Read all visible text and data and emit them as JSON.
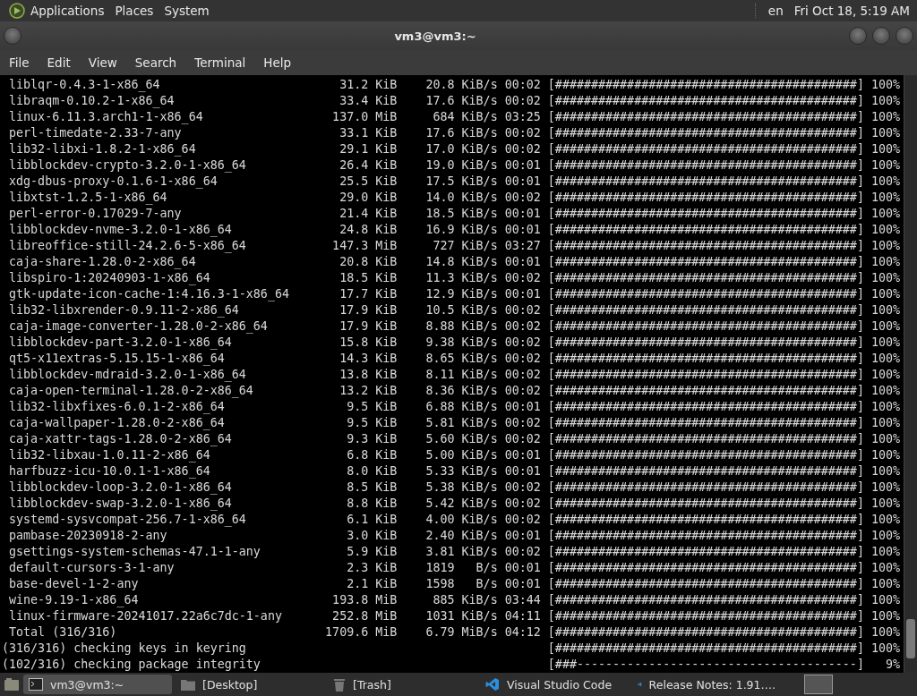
{
  "top_panel": {
    "menus": [
      "Applications",
      "Places",
      "System"
    ],
    "keyboard": "en",
    "clock": "Fri Oct 18, 5:19 AM"
  },
  "window": {
    "title": "vm3@vm3:~"
  },
  "menu_bar": [
    "File",
    "Edit",
    "View",
    "Search",
    "Terminal",
    "Help"
  ],
  "terminal": {
    "lines": [
      {
        "kind": "download",
        "name": "liblqr-0.4.3-1-x86_64",
        "size": "31.2 KiB",
        "rate": "20.8",
        "unit": "KiB/s",
        "time": "00:02",
        "bar": "[##########################################]",
        "percent": "100%"
      },
      {
        "kind": "download",
        "name": "libraqm-0.10.2-1-x86_64",
        "size": "33.4 KiB",
        "rate": "17.6",
        "unit": "KiB/s",
        "time": "00:02",
        "bar": "[##########################################]",
        "percent": "100%"
      },
      {
        "kind": "download",
        "name": "linux-6.11.3.arch1-1-x86_64",
        "size": "137.0 MiB",
        "rate": "684",
        "unit": "KiB/s",
        "time": "03:25",
        "bar": "[##########################################]",
        "percent": "100%"
      },
      {
        "kind": "download",
        "name": "perl-timedate-2.33-7-any",
        "size": "33.1 KiB",
        "rate": "17.6",
        "unit": "KiB/s",
        "time": "00:02",
        "bar": "[##########################################]",
        "percent": "100%"
      },
      {
        "kind": "download",
        "name": "lib32-libxi-1.8.2-1-x86_64",
        "size": "29.1 KiB",
        "rate": "17.0",
        "unit": "KiB/s",
        "time": "00:02",
        "bar": "[##########################################]",
        "percent": "100%"
      },
      {
        "kind": "download",
        "name": "libblockdev-crypto-3.2.0-1-x86_64",
        "size": "26.4 KiB",
        "rate": "19.0",
        "unit": "KiB/s",
        "time": "00:01",
        "bar": "[##########################################]",
        "percent": "100%"
      },
      {
        "kind": "download",
        "name": "xdg-dbus-proxy-0.1.6-1-x86_64",
        "size": "25.5 KiB",
        "rate": "17.5",
        "unit": "KiB/s",
        "time": "00:01",
        "bar": "[##########################################]",
        "percent": "100%"
      },
      {
        "kind": "download",
        "name": "libxtst-1.2.5-1-x86_64",
        "size": "29.0 KiB",
        "rate": "14.0",
        "unit": "KiB/s",
        "time": "00:02",
        "bar": "[##########################################]",
        "percent": "100%"
      },
      {
        "kind": "download",
        "name": "perl-error-0.17029-7-any",
        "size": "21.4 KiB",
        "rate": "18.5",
        "unit": "KiB/s",
        "time": "00:01",
        "bar": "[##########################################]",
        "percent": "100%"
      },
      {
        "kind": "download",
        "name": "libblockdev-nvme-3.2.0-1-x86_64",
        "size": "24.8 KiB",
        "rate": "16.9",
        "unit": "KiB/s",
        "time": "00:01",
        "bar": "[##########################################]",
        "percent": "100%"
      },
      {
        "kind": "download",
        "name": "libreoffice-still-24.2.6-5-x86_64",
        "size": "147.3 MiB",
        "rate": "727",
        "unit": "KiB/s",
        "time": "03:27",
        "bar": "[##########################################]",
        "percent": "100%"
      },
      {
        "kind": "download",
        "name": "caja-share-1.28.0-2-x86_64",
        "size": "20.8 KiB",
        "rate": "14.8",
        "unit": "KiB/s",
        "time": "00:01",
        "bar": "[##########################################]",
        "percent": "100%"
      },
      {
        "kind": "download",
        "name": "libspiro-1:20240903-1-x86_64",
        "size": "18.5 KiB",
        "rate": "11.3",
        "unit": "KiB/s",
        "time": "00:02",
        "bar": "[##########################################]",
        "percent": "100%"
      },
      {
        "kind": "download",
        "name": "gtk-update-icon-cache-1:4.16.3-1-x86_64",
        "size": "17.7 KiB",
        "rate": "12.9",
        "unit": "KiB/s",
        "time": "00:01",
        "bar": "[##########################################]",
        "percent": "100%"
      },
      {
        "kind": "download",
        "name": "lib32-libxrender-0.9.11-2-x86_64",
        "size": "17.9 KiB",
        "rate": "10.5",
        "unit": "KiB/s",
        "time": "00:02",
        "bar": "[##########################################]",
        "percent": "100%"
      },
      {
        "kind": "download",
        "name": "caja-image-converter-1.28.0-2-x86_64",
        "size": "17.9 KiB",
        "rate": "8.88",
        "unit": "KiB/s",
        "time": "00:02",
        "bar": "[##########################################]",
        "percent": "100%"
      },
      {
        "kind": "download",
        "name": "libblockdev-part-3.2.0-1-x86_64",
        "size": "15.8 KiB",
        "rate": "9.38",
        "unit": "KiB/s",
        "time": "00:02",
        "bar": "[##########################################]",
        "percent": "100%"
      },
      {
        "kind": "download",
        "name": "qt5-x11extras-5.15.15-1-x86_64",
        "size": "14.3 KiB",
        "rate": "8.65",
        "unit": "KiB/s",
        "time": "00:02",
        "bar": "[##########################################]",
        "percent": "100%"
      },
      {
        "kind": "download",
        "name": "libblockdev-mdraid-3.2.0-1-x86_64",
        "size": "13.8 KiB",
        "rate": "8.11",
        "unit": "KiB/s",
        "time": "00:02",
        "bar": "[##########################################]",
        "percent": "100%"
      },
      {
        "kind": "download",
        "name": "caja-open-terminal-1.28.0-2-x86_64",
        "size": "13.2 KiB",
        "rate": "8.36",
        "unit": "KiB/s",
        "time": "00:02",
        "bar": "[##########################################]",
        "percent": "100%"
      },
      {
        "kind": "download",
        "name": "lib32-libxfixes-6.0.1-2-x86_64",
        "size": "9.5 KiB",
        "rate": "6.88",
        "unit": "KiB/s",
        "time": "00:01",
        "bar": "[##########################################]",
        "percent": "100%"
      },
      {
        "kind": "download",
        "name": "caja-wallpaper-1.28.0-2-x86_64",
        "size": "9.5 KiB",
        "rate": "5.81",
        "unit": "KiB/s",
        "time": "00:02",
        "bar": "[##########################################]",
        "percent": "100%"
      },
      {
        "kind": "download",
        "name": "caja-xattr-tags-1.28.0-2-x86_64",
        "size": "9.3 KiB",
        "rate": "5.60",
        "unit": "KiB/s",
        "time": "00:02",
        "bar": "[##########################################]",
        "percent": "100%"
      },
      {
        "kind": "download",
        "name": "lib32-libxau-1.0.11-2-x86_64",
        "size": "6.8 KiB",
        "rate": "5.00",
        "unit": "KiB/s",
        "time": "00:01",
        "bar": "[##########################################]",
        "percent": "100%"
      },
      {
        "kind": "download",
        "name": "harfbuzz-icu-10.0.1-1-x86_64",
        "size": "8.0 KiB",
        "rate": "5.33",
        "unit": "KiB/s",
        "time": "00:01",
        "bar": "[##########################################]",
        "percent": "100%"
      },
      {
        "kind": "download",
        "name": "libblockdev-loop-3.2.0-1-x86_64",
        "size": "8.5 KiB",
        "rate": "5.38",
        "unit": "KiB/s",
        "time": "00:02",
        "bar": "[##########################################]",
        "percent": "100%"
      },
      {
        "kind": "download",
        "name": "libblockdev-swap-3.2.0-1-x86_64",
        "size": "8.8 KiB",
        "rate": "5.42",
        "unit": "KiB/s",
        "time": "00:02",
        "bar": "[##########################################]",
        "percent": "100%"
      },
      {
        "kind": "download",
        "name": "systemd-sysvcompat-256.7-1-x86_64",
        "size": "6.1 KiB",
        "rate": "4.00",
        "unit": "KiB/s",
        "time": "00:02",
        "bar": "[##########################################]",
        "percent": "100%"
      },
      {
        "kind": "download",
        "name": "pambase-20230918-2-any",
        "size": "3.0 KiB",
        "rate": "2.40",
        "unit": "KiB/s",
        "time": "00:01",
        "bar": "[##########################################]",
        "percent": "100%"
      },
      {
        "kind": "download",
        "name": "gsettings-system-schemas-47.1-1-any",
        "size": "5.9 KiB",
        "rate": "3.81",
        "unit": "KiB/s",
        "time": "00:02",
        "bar": "[##########################################]",
        "percent": "100%"
      },
      {
        "kind": "download",
        "name": "default-cursors-3-1-any",
        "size": "2.3 KiB",
        "rate": "1819",
        "unit": "B/s",
        "time": "00:01",
        "bar": "[##########################################]",
        "percent": "100%"
      },
      {
        "kind": "download",
        "name": "base-devel-1-2-any",
        "size": "2.1 KiB",
        "rate": "1598",
        "unit": "B/s",
        "time": "00:01",
        "bar": "[##########################################]",
        "percent": "100%"
      },
      {
        "kind": "download",
        "name": "wine-9.19-1-x86_64",
        "size": "193.8 MiB",
        "rate": "885",
        "unit": "KiB/s",
        "time": "03:44",
        "bar": "[##########################################]",
        "percent": "100%"
      },
      {
        "kind": "download",
        "name": "linux-firmware-20241017.22a6c7dc-1-any",
        "size": "252.8 MiB",
        "rate": "1031",
        "unit": "KiB/s",
        "time": "04:11",
        "bar": "[##########################################]",
        "percent": "100%"
      },
      {
        "kind": "download",
        "name": "Total (316/316)",
        "size": "1709.6 MiB",
        "rate": "6.79",
        "unit": "MiB/s",
        "time": "04:12",
        "bar": "[##########################################]",
        "percent": "100%"
      },
      {
        "kind": "check",
        "name": "(316/316) checking keys in keyring",
        "bar": "[##########################################]",
        "percent": "100%"
      },
      {
        "kind": "check",
        "name": "(102/316) checking package integrity",
        "bar": "[###---------------------------------------]",
        "percent": "9%"
      }
    ]
  },
  "taskbar": {
    "tasks": [
      {
        "label": "vm3@vm3:~",
        "kind": "terminal",
        "selected": true
      },
      {
        "label": "[Desktop]",
        "kind": "folder",
        "selected": false
      },
      {
        "label": "[Trash]",
        "kind": "trash",
        "selected": false
      },
      {
        "label": "Visual Studio Code",
        "kind": "editor",
        "selected": false
      },
      {
        "label": "Release Notes: 1.91….",
        "kind": "editor",
        "selected": false
      }
    ]
  }
}
